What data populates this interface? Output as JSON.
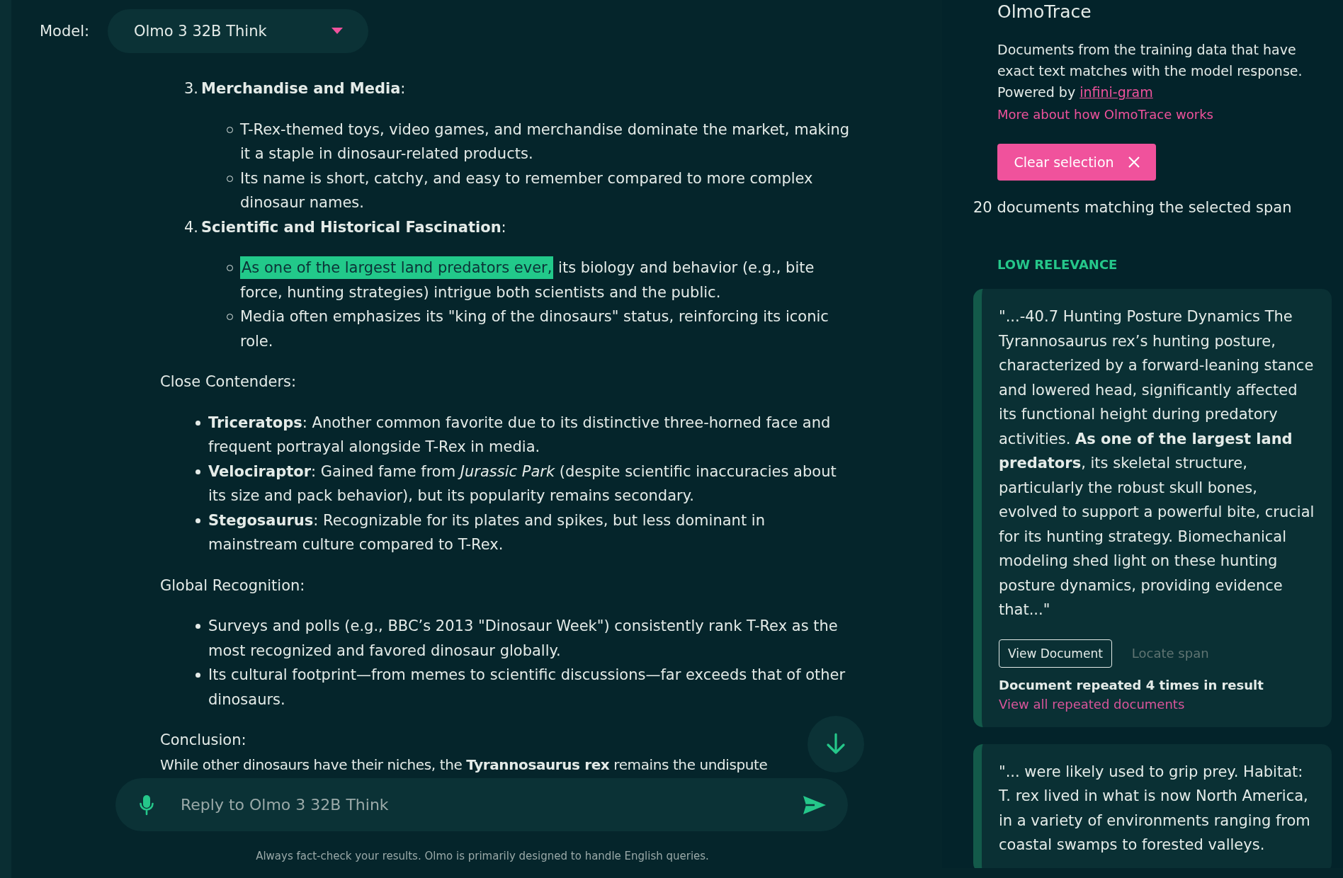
{
  "model_selector": {
    "label": "Model:",
    "value": "Olmo 3 32B Think"
  },
  "response": [
    {
      "kind": "numbered",
      "number": "3.",
      "title": "**Merchandise and Media**:",
      "items": [
        {
          "segments": [
            {
              "text": "T-Rex-themed toys, video games, and merchandise dominate the market, making it a staple in dinosaur-related products.",
              "highlighted": false
            }
          ]
        },
        {
          "segments": [
            {
              "text": "Its name is short, catchy, and easy to remember compared to more complex dinosaur names.",
              "highlighted": false
            }
          ]
        }
      ]
    },
    {
      "kind": "numbered",
      "number": "4.",
      "title": "**Scientific and Historical Fascination**:",
      "items": [
        {
          "segments": [
            {
              "text": "As one of the largest land predators ever,",
              "highlighted": true
            },
            {
              "text": " its biology and behavior (e.g., bite force, hunting strategies) intrigue both scientists and the public.",
              "highlighted": false
            }
          ]
        },
        {
          "segments": [
            {
              "text": "Media often emphasizes its \"king of the dinosaurs\" status, reinforcing its iconic role.",
              "highlighted": false
            }
          ]
        }
      ]
    },
    {
      "kind": "heading",
      "text": "Close Contenders:"
    },
    {
      "kind": "bullets",
      "items": [
        "**Triceratops**: Another common favorite due to its distinctive three-horned face and frequent portrayal alongside T-Rex in media.",
        "**Velociraptor**: Gained fame from *Jurassic Park* (despite scientific inaccuracies about its size and pack behavior), but its popularity remains secondary.",
        "**Stegosaurus**: Recognizable for its plates and spikes, but less dominant in mainstream culture compared to T-Rex."
      ]
    },
    {
      "kind": "heading",
      "text": "Global Recognition:"
    },
    {
      "kind": "bullets",
      "items": [
        "Surveys and polls (e.g., BBC’s 2013 \"Dinosaur Week\") consistently rank T-Rex as the most recognized and favored dinosaur globally.",
        "Its cultural footprint—from memes to scientific discussions—far exceeds that of other dinosaurs."
      ]
    },
    {
      "kind": "heading",
      "text": "Conclusion:"
    },
    {
      "kind": "paragraph",
      "text": "While other dinosaurs have their niches, the **Tyrannosaurus rex** remains the undispute"
    }
  ],
  "reply_input": {
    "placeholder": "Reply to Olmo 3 32B Think"
  },
  "disclaimer": "Always fact-check your results. Olmo is primarily designed to handle English queries.",
  "trace_panel": {
    "title": "OlmoTrace",
    "description": "Documents from the training data that have exact text matches with the model response.",
    "powered_by": "Powered by",
    "powered_by_link": "infini-gram",
    "more_link": "More about how OlmoTrace works",
    "clear_button": "Clear selection",
    "match_count": "20 documents matching the selected span",
    "relevance_label": "LOW RELEVANCE",
    "documents": [
      {
        "text": "\"...-40.7 Hunting Posture Dynamics The Tyrannosaurus rex’s hunting posture, characterized by a forward-leaning stance and lowered head, significantly affected its functional height during predatory activities. **As one of the largest land predators**, its skeletal structure, particularly the robust skull bones, evolved to support a powerful bite, crucial for its hunting strategy. Biomechanical modeling shed light on these hunting posture dynamics, providing evidence that...\"",
        "view_button": "View Document",
        "locate_button": "Locate span",
        "locate_disabled": true,
        "repeat_note": "Document repeated 4 times in result",
        "repeat_link": "View all repeated documents"
      },
      {
        "text": "\"... were likely used to grip prey. Habitat: T. rex lived in what is now North America, in a variety of environments ranging from coastal swamps to forested valleys."
      }
    ]
  }
}
